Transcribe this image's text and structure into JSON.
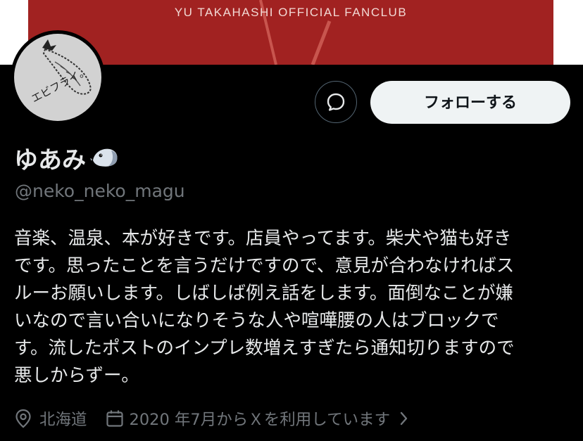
{
  "banner": {
    "text": "YU TAKAHASHI OFFICIAL FANCLUB"
  },
  "avatar": {
    "text": "エビフライ。"
  },
  "actions": {
    "follow_label": "フォローする"
  },
  "profile": {
    "display_name": "ゆあみ",
    "name_emoji": "bird-emoji",
    "handle": "@neko_neko_magu",
    "bio_lines": [
      "音楽、温泉、本が好きです。店員やってます。柴犬や猫も好き",
      "です。思ったことを言うだけですので、意見が合わなければス",
      "ルーお願いします。しばしば例え話をします。面倒なことが嫌",
      "いなので言い合いになりそうな人や喧嘩腰の人はブロックで",
      "す。流したポストのインプレ数増えすぎたら通知切りますので",
      "悪しからずー。"
    ],
    "location": "北海道",
    "joined": "2020 年7月からＸを利用しています"
  },
  "icons": [
    "location-pin-icon",
    "calendar-icon",
    "chevron-right-icon",
    "message-bubble-icon"
  ],
  "colors": {
    "background": "#000000",
    "banner": "#a12221",
    "primary_text": "#e7e9ea",
    "secondary_text": "#71767b",
    "follow_button": "#eff3f4"
  }
}
